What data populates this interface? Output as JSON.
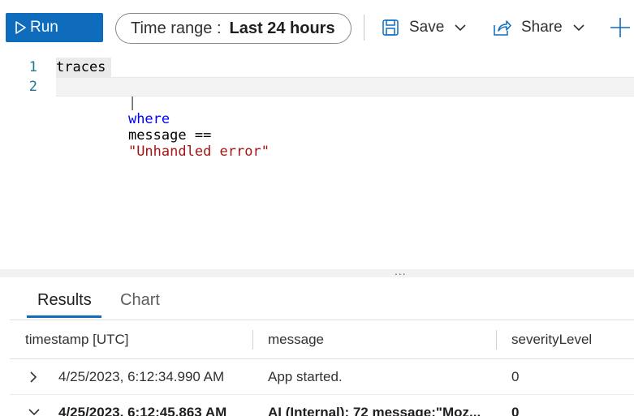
{
  "toolbar": {
    "run_label": "Run",
    "time_range_label": "Time range :",
    "time_range_value": "Last 24 hours",
    "save_label": "Save",
    "share_label": "Share",
    "accent_color": "#0f6cbd"
  },
  "editor": {
    "line_numbers": [
      "1",
      "2"
    ],
    "line1": "traces",
    "line2_guide": "|",
    "line2_keyword": "where",
    "line2_field": "message ==",
    "line2_string": "\"Unhandled error\""
  },
  "results": {
    "splitter_handle": "...",
    "tabs": [
      {
        "label": "Results",
        "active": true
      },
      {
        "label": "Chart",
        "active": false
      }
    ],
    "columns": [
      "timestamp [UTC]",
      "message",
      "severityLevel"
    ],
    "rows": [
      {
        "expanded": false,
        "timestamp": "4/25/2023, 6:12:34.990 AM",
        "message": "App started.",
        "severity": "0"
      },
      {
        "expanded": true,
        "timestamp": "4/25/2023, 6:12:45.863 AM",
        "message": "AI (Internal): 72 message:\"Moz...",
        "severity": "0"
      }
    ]
  },
  "icons": [
    "play-icon",
    "save-icon",
    "chevron-down-icon",
    "share-icon",
    "plus-icon",
    "chevron-right-icon"
  ]
}
